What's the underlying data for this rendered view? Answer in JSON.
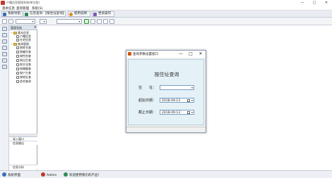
{
  "window": {
    "title": "户籍信息管理系统(单位版)",
    "minimize": "—",
    "maximize": "□",
    "close": "✕"
  },
  "menu": [
    "基本信息",
    "查询管理",
    "系统(S)"
  ],
  "tabs": [
    {
      "label": "系统导航",
      "icon_color": "#3a6fb5"
    },
    {
      "label": "信息查询-【按住址查询】",
      "icon_color": "#2e8b57"
    },
    {
      "label": "使用说明",
      "icon_color": "#d98c1f"
    },
    {
      "label": "更多操作",
      "icon_color": "#7a5bb0"
    }
  ],
  "tree": {
    "header": "管理导航",
    "close_glyph": "×",
    "groups": [
      {
        "label": "基本信息",
        "items": [
          "户籍信息",
          "住宅信息"
        ]
      },
      {
        "label": "查询管理",
        "items": [
          "按姓名查",
          "按编号查",
          "按性别查",
          "按出生查",
          "按文化查",
          "按婚姻查",
          "按户主查",
          "按地址查",
          "综合查询"
        ]
      }
    ],
    "bottom": [
      "录入窗口",
      "信息输出"
    ],
    "footer": "信息分析"
  },
  "dialog": {
    "title": "查询参数设置窗口",
    "minimize": "—",
    "maximize": "□",
    "close": "✕",
    "heading": "按住址查询",
    "address_label": "住　　址：",
    "address_value": "",
    "start_label": "起始日期：",
    "start_value": "2018-09-13",
    "end_label": "截止日期：",
    "end_value": "2018-09-13"
  },
  "status": {
    "system": "系统界面",
    "user": "Admin",
    "welcome": "欢迎使用我们的产品！"
  },
  "colors": {
    "accent": "#3a6fb5",
    "dialog_body": "#e4f1f6"
  }
}
